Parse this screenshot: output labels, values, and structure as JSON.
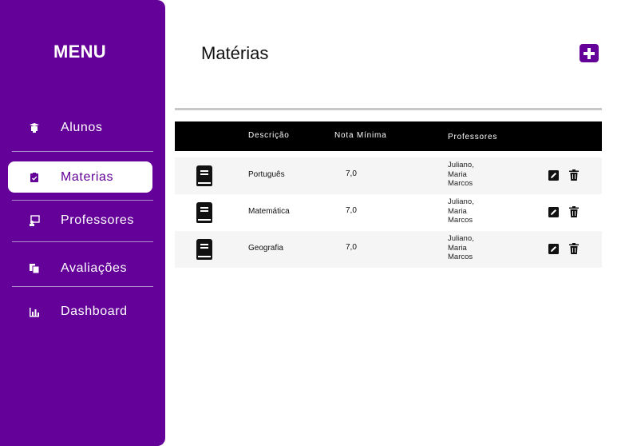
{
  "sidebar": {
    "title": "MENU",
    "items": [
      {
        "label": "Alunos",
        "icon": "student-icon"
      },
      {
        "label": "Materias",
        "icon": "clipboard-check-icon",
        "active": true
      },
      {
        "label": "Professores",
        "icon": "teacher-icon"
      },
      {
        "label": "Avaliações",
        "icon": "documents-icon"
      },
      {
        "label": "Dashboard",
        "icon": "bar-chart-icon"
      }
    ]
  },
  "header": {
    "title": "Matérias",
    "add_icon": "plus-icon"
  },
  "table": {
    "columns": {
      "descricao": "Descrição",
      "nota": "Nota Mínima",
      "professores": "Professores"
    },
    "rows": [
      {
        "icon": "book-icon",
        "descricao": "Português",
        "nota": "7,0",
        "professores": [
          "Juliano,",
          "Maria",
          "Marcos"
        ]
      },
      {
        "icon": "book-icon",
        "descricao": "Matemática",
        "nota": "7,0",
        "professores": [
          "Juliano,",
          "Maria",
          "Marcos"
        ]
      },
      {
        "icon": "book-icon",
        "descricao": "Geografia",
        "nota": "7,0",
        "professores": [
          "Juliano,",
          "Maria",
          "Marcos"
        ]
      }
    ]
  },
  "colors": {
    "accent": "#640198",
    "header_bg": "#000000",
    "row_shade": "#f5f5f5"
  }
}
